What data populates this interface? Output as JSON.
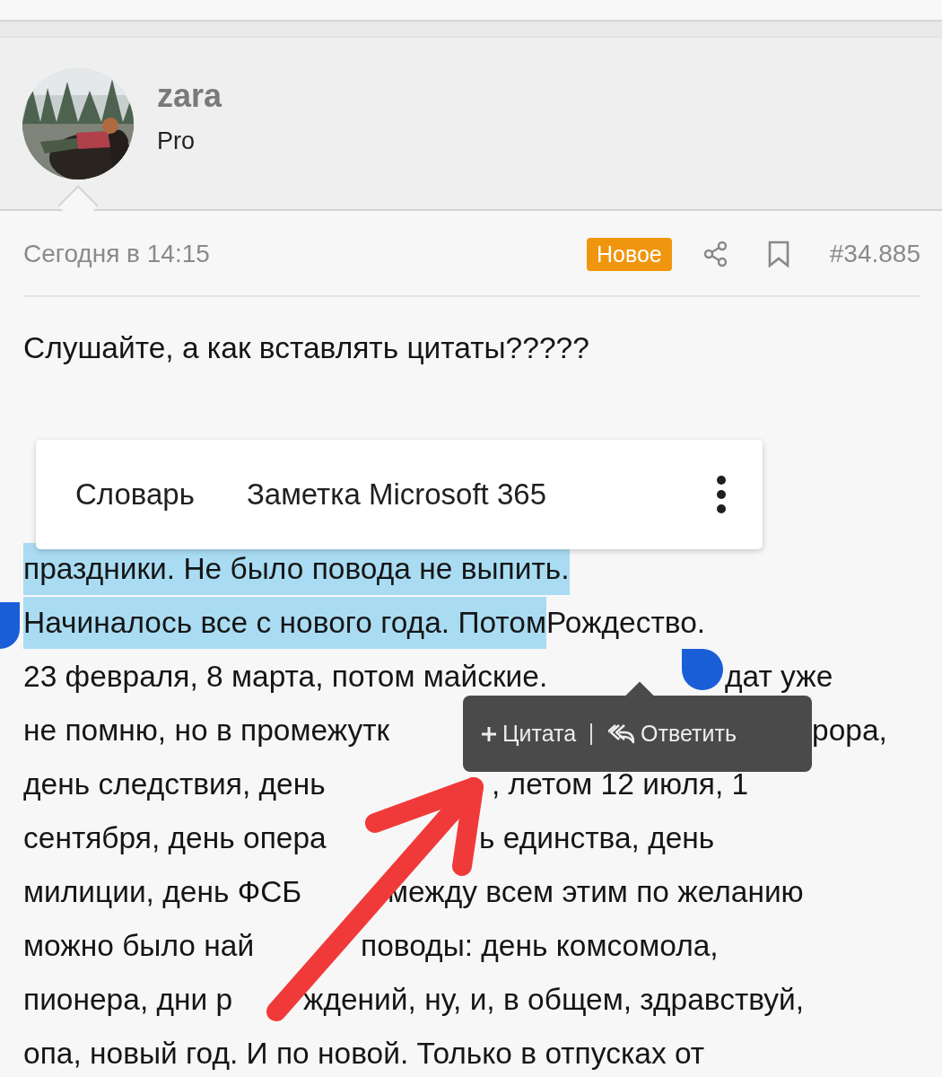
{
  "author": {
    "name": "zara",
    "title": "Pro"
  },
  "post": {
    "date": "Сегодня в 14:15",
    "badge": "Новое",
    "number": "#34.885",
    "paragraphs": [
      {
        "lines": [
          {
            "parts": [
              {
                "text": "Слушайте, а как вставлять цитаты?????",
                "selected": false
              }
            ]
          }
        ]
      },
      {
        "lines": [
          {
            "parts": [
              {
                "text": "праздники. Не было повода не выпить.",
                "selected": true
              }
            ]
          },
          {
            "parts": [
              {
                "text": "Начиналось все с нового года. Потом",
                "selected": true
              },
              {
                "text": " Рождество.",
                "selected": false
              }
            ]
          },
          {
            "parts": [
              {
                "text": "23 февраля, 8 марта, потом майские.",
                "selected": false
              },
              {
                "text": "дат уже",
                "selected": false
              }
            ]
          },
          {
            "parts": [
              {
                "text": "не помню, но в промежутк",
                "selected": false
              },
              {
                "text": "рора,",
                "selected": false
              }
            ]
          },
          {
            "parts": [
              {
                "text": "день следствия, день",
                "selected": false
              },
              {
                "text": ", летом 12 июля, 1",
                "selected": false
              }
            ]
          },
          {
            "parts": [
              {
                "text": "сентября, день опера",
                "selected": false
              },
              {
                "text": "ь единства, день",
                "selected": false
              }
            ]
          },
          {
            "parts": [
              {
                "text": "милиции, день ФСБ",
                "selected": false
              },
              {
                "text": "между всем этим по желанию",
                "selected": false
              }
            ]
          },
          {
            "parts": [
              {
                "text": "можно было най",
                "selected": false
              },
              {
                "text": "поводы: день комсомола,",
                "selected": false
              }
            ]
          },
          {
            "parts": [
              {
                "text": "пионера, дни р",
                "selected": false
              },
              {
                "text": "ждений, ну, и, в общем, здравствуй,",
                "selected": false
              }
            ]
          },
          {
            "parts": [
              {
                "text": "опа, новый год. И по новой. Только в отпусках от",
                "selected": false
              }
            ]
          }
        ]
      }
    ]
  },
  "selection_menu": {
    "items": [
      "Словарь",
      "Заметка Microsoft 365"
    ]
  },
  "quote_bar": {
    "buttons": [
      "Цитата",
      "Ответить"
    ]
  }
}
